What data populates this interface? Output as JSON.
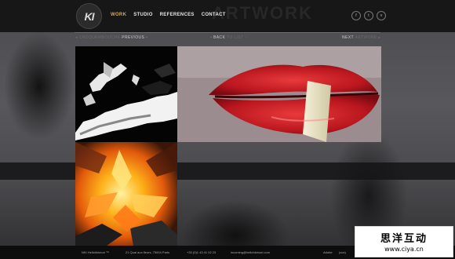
{
  "header": {
    "logo_text": "KI",
    "ghost_title": "ARTWORK",
    "nav": [
      {
        "label": "WORK",
        "active": true
      },
      {
        "label": "STUDIO",
        "active": false
      },
      {
        "label": "REFERENCES",
        "active": false
      },
      {
        "label": "CONTACT",
        "active": false
      }
    ],
    "social": [
      {
        "icon": "facebook-icon",
        "glyph": "f"
      },
      {
        "icon": "twitter-icon",
        "glyph": "t"
      },
      {
        "icon": "vimeo-icon",
        "glyph": "v"
      }
    ]
  },
  "subnav": {
    "prev_project": "◂ CROQUEMBOUCHE",
    "prev_label": "PREVIOUS ◦",
    "back_label": "◦ BACK",
    "back_target": "TO LIST ◦",
    "next_label": "NEXT",
    "next_project": "ARTWORK ▸"
  },
  "footer": {
    "company": "NKI Hellohkimori ™",
    "address": "21 Quai aux fleurs, 75004 Paris",
    "phone": "+33 (0)1 43 41 02 23",
    "email": "incoming@hellohkimori.com",
    "client1": "Adobe",
    "client2": "(cce)"
  },
  "watermark": {
    "line1": "思洋互动",
    "line2": "www.ciya.cn"
  },
  "colors": {
    "accent": "#d4a955",
    "header_bg": "#121212",
    "lips_red": "#c2242b"
  }
}
